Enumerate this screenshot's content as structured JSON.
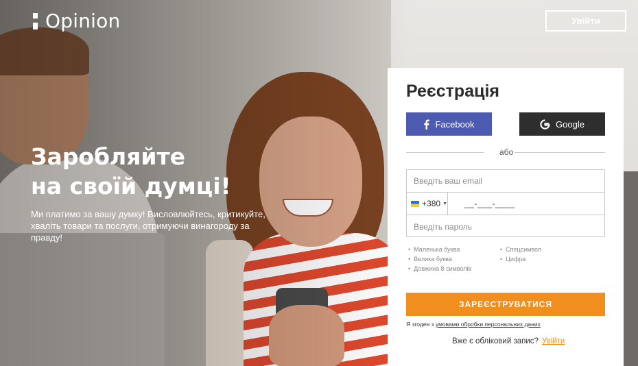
{
  "brand": {
    "name": "Opinion"
  },
  "header": {
    "login_label": "Увійти"
  },
  "hero": {
    "headline_line1": "Заробляйте",
    "headline_line2": "на своїй думці!",
    "sub_line1": "Ми платимо за вашу думку! Висловлюйтесь, критикуйте,",
    "sub_line2": "хваліть товари та послуги, отримуючи винагороду за правду!"
  },
  "signup": {
    "title": "Реєстрація",
    "facebook_label": "Facebook",
    "google_label": "Google",
    "or_label": "або",
    "email_placeholder": "Введіть ваш email",
    "phone_code": "+380",
    "phone_mask": "__-___-____",
    "password_placeholder": "Введіть пароль",
    "requirements_left": [
      "Маленька буква",
      "Велика буква",
      "Довжина 8 символів"
    ],
    "requirements_right": [
      "Спецсимвол",
      "Цифра"
    ],
    "submit_label": "ЗАРЕЄСТРУВАТИСЯ",
    "agree_prefix": "Я згоден з",
    "agree_link": "умовами обробки персональних даних",
    "already_text": "Вже є обліковий запис?",
    "already_link": "Увійти"
  },
  "colors": {
    "facebook": "#4c5bb0",
    "google": "#2e2e2e",
    "accent": "#f08f1d"
  }
}
